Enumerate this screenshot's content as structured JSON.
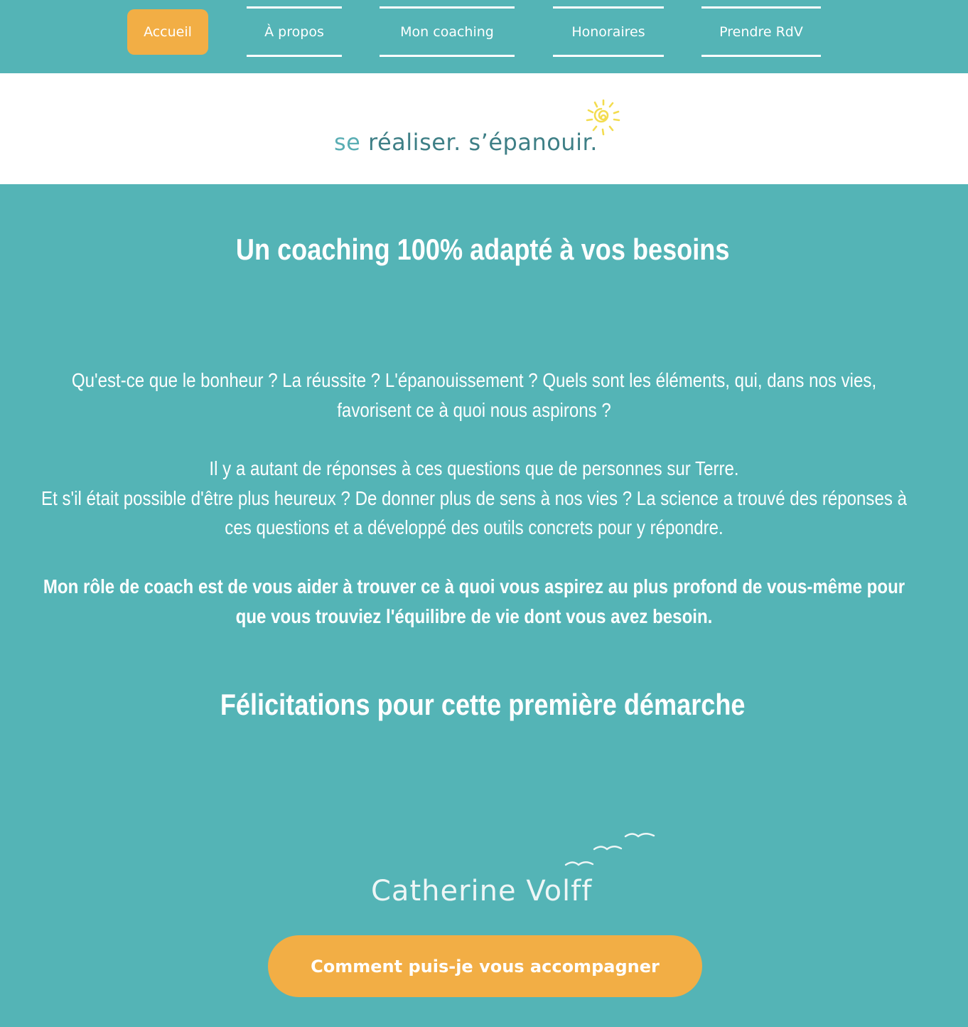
{
  "nav": {
    "items": [
      {
        "label": "Accueil",
        "active": true
      },
      {
        "label": "À propos",
        "active": false
      },
      {
        "label": "Mon coaching",
        "active": false
      },
      {
        "label": "Honoraires",
        "active": false
      },
      {
        "label": "Prendre RdV",
        "active": false
      }
    ]
  },
  "banner": {
    "tagline_se": "se",
    "tagline_rest": "réaliser. s’épanouir."
  },
  "main": {
    "heading": "Un coaching 100% adapté à vos besoins",
    "paragraph1": "Qu'est-ce que le bonheur ? La réussite ? L'épanouissement ? Quels sont les éléments, qui, dans nos vies, favorisent ce à quoi nous aspirons ?",
    "paragraph2_line1": "Il y a autant de réponses à ces questions que de personnes sur Terre.",
    "paragraph2_line2": "Et s'il était possible d'être plus heureux ? De donner plus de sens à nos vies ? La science a trouvé des réponses à ces questions et a développé des outils concrets pour y répondre.",
    "paragraph3": "Mon rôle de coach est de vous aider à trouver ce à quoi vous aspirez au plus profond de vous-même pour que vous trouviez l'équilibre de vie dont vous avez besoin.",
    "heading2": "Félicitations pour cette première démarche"
  },
  "signature": {
    "name": "Catherine Volff"
  },
  "cta": {
    "label": "Comment puis-je vous accompagner"
  },
  "colors": {
    "background": "#54b4b6",
    "accent": "#f2ae45",
    "tagline": "#3e7f86",
    "sun": "#f3dc4f"
  }
}
